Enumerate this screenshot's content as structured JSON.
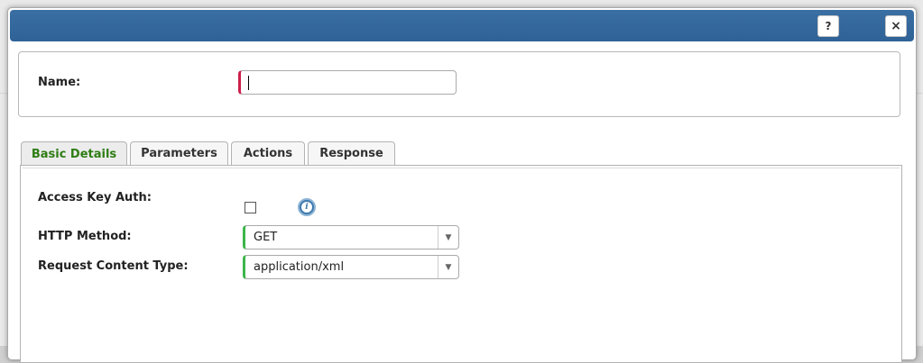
{
  "dialog": {
    "help_label": "?",
    "close_label": "×"
  },
  "name_section": {
    "label": "Name:",
    "value": ""
  },
  "tabs": [
    {
      "label": "Basic Details",
      "active": true
    },
    {
      "label": "Parameters",
      "active": false
    },
    {
      "label": "Actions",
      "active": false
    },
    {
      "label": "Response",
      "active": false
    }
  ],
  "basic_details": {
    "access_key_auth": {
      "label": "Access Key Auth:",
      "checked": false,
      "info_icon": "info-icon"
    },
    "http_method": {
      "label": "HTTP Method:",
      "value": "GET"
    },
    "request_content_type": {
      "label": "Request Content Type:",
      "value": "application/xml"
    }
  },
  "colors": {
    "titlebar": "#336699",
    "required_marker": "#cc1f4b",
    "valid_marker": "#3cb54a",
    "active_tab_text": "#2e7d14"
  }
}
